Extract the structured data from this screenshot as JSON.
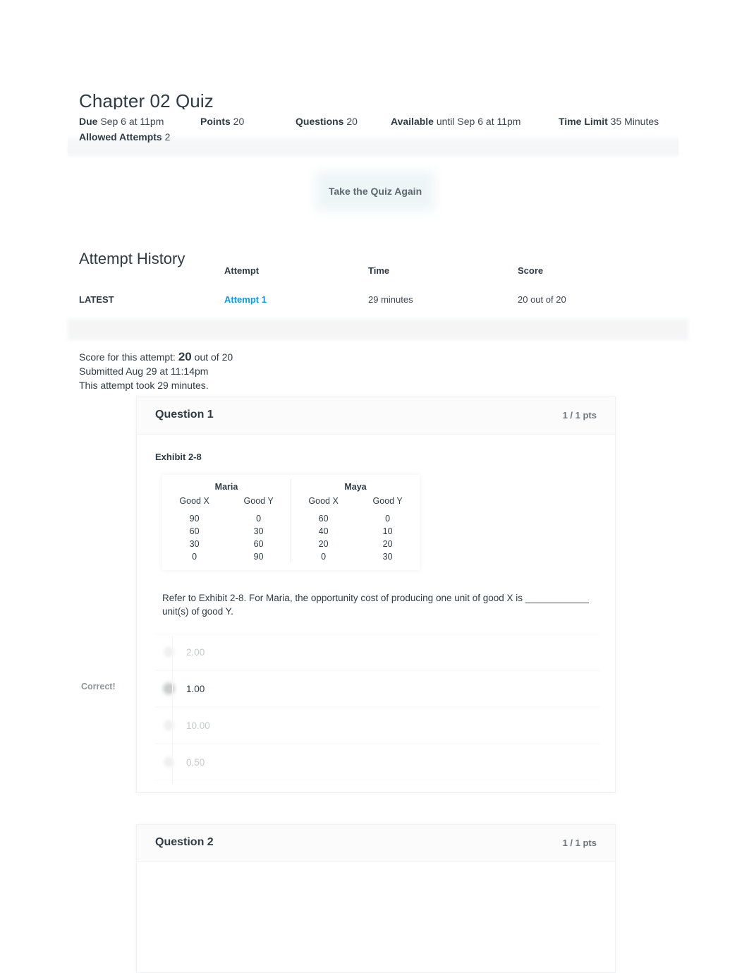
{
  "page": {
    "title": "Chapter 02 Quiz"
  },
  "meta": [
    {
      "label": "Due",
      "value": "Sep 6 at 11pm"
    },
    {
      "label": "Points",
      "value": "20"
    },
    {
      "label": "Questions",
      "value": "20"
    },
    {
      "label": "Available",
      "value": "until Sep 6 at 11pm"
    },
    {
      "label": "Time Limit",
      "value": "35 Minutes"
    },
    {
      "label": "Allowed Attempts",
      "value": "2"
    }
  ],
  "retake": {
    "label": "Take the Quiz Again"
  },
  "attempt_history": {
    "heading": "Attempt History",
    "headers": [
      "",
      "Attempt",
      "Time",
      "Score"
    ],
    "rows": [
      {
        "kept": "LATEST",
        "attempt": "Attempt 1",
        "time": "29 minutes",
        "score": "20 out of 20"
      }
    ]
  },
  "score_summary": {
    "score_prefix": "Score for this attempt:",
    "score_value": "20",
    "score_suffix": "out of 20",
    "submitted": "Submitted Aug 29 at 11:14pm",
    "duration": "This attempt took 29 minutes."
  },
  "questions": [
    {
      "name": "Question 1",
      "points": "1 / 1 pts",
      "exhibit_label": "Exhibit 2-8",
      "exhibit": {
        "people": [
          "Maria",
          "Maya"
        ],
        "column_headers": [
          "Good X",
          "Good Y"
        ],
        "maria": [
          [
            "90",
            "0"
          ],
          [
            "60",
            "30"
          ],
          [
            "30",
            "60"
          ],
          [
            "0",
            "90"
          ]
        ],
        "maya": [
          [
            "60",
            "0"
          ],
          [
            "40",
            "10"
          ],
          [
            "20",
            "20"
          ],
          [
            "0",
            "30"
          ]
        ]
      },
      "text": "Refer to Exhibit 2-8. For Maria, the opportunity cost of producing one unit of good X is ____________ unit(s) of good Y.",
      "correct_flag": "Correct!",
      "answers": [
        {
          "label": "2.00",
          "selected": false
        },
        {
          "label": "1.00",
          "selected": true
        },
        {
          "label": "10.00",
          "selected": false
        },
        {
          "label": "0.50",
          "selected": false
        }
      ]
    },
    {
      "name": "Question 2",
      "points": "1 / 1 pts"
    }
  ],
  "colors": {
    "link": "#0a9ae0",
    "text": "#2d3b45",
    "muted": "#6c757d"
  }
}
